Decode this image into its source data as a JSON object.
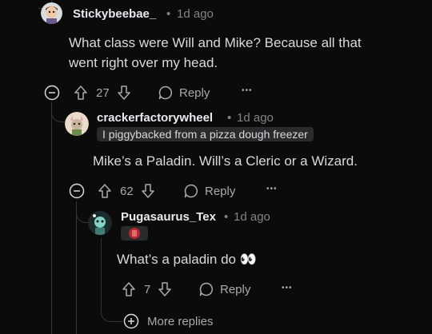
{
  "comments": [
    {
      "username": "Stickybeebae_",
      "time": "1d ago",
      "text": "What class were Will and Mike? Because all that went right over my head.",
      "votes": "27",
      "reply_label": "Reply"
    },
    {
      "username": "crackerfactorywheel",
      "time": "1d ago",
      "flair": "I piggybacked from a pizza dough freezer",
      "text": "Mike’s a Paladin. Will’s a Cleric or a Wizard.",
      "votes": "62",
      "reply_label": "Reply"
    },
    {
      "username": "Pugasaurus_Tex",
      "time": "1d ago",
      "text": "What’s a paladin do 👀",
      "votes": "7",
      "reply_label": "Reply"
    }
  ],
  "more_replies_label": "More replies",
  "separator": "•",
  "overflow": "•••",
  "colors": {
    "background": "#0b0b0c",
    "text": "#d7dadc",
    "muted": "#818384",
    "thread_line": "#343536"
  }
}
